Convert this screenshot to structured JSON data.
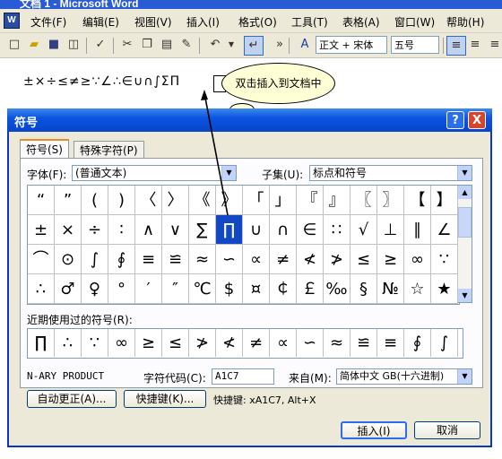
{
  "window": {
    "title": "文档 1 - Microsoft Word"
  },
  "menubar": {
    "items": [
      "文件(F)",
      "编辑(E)",
      "视图(V)",
      "插入(I)",
      "格式(O)",
      "工具(T)",
      "表格(A)",
      "窗口(W)",
      "帮助(H)"
    ]
  },
  "toolbar": {
    "style_value": "正文 + 宋体",
    "size_value": "五号"
  },
  "document": {
    "symbol_text": "±×÷≤≠≥∵∠∴∈∪∩∫ΣΠ",
    "callout": "双击插入到文档中"
  },
  "dialog": {
    "title": "符号",
    "help_label": "?",
    "close_label": "X",
    "tabs": [
      "符号(S)",
      "特殊字符(P)"
    ],
    "font_label": "字体(F):",
    "font_value": "(普通文本)",
    "subset_label": "子集(U):",
    "subset_value": "标点和符号",
    "grid": [
      [
        "“",
        "”",
        "(",
        ")",
        "〈",
        "〉",
        "《",
        "》",
        "「",
        "」",
        "『",
        "』",
        "〖",
        "〗",
        "【",
        "】"
      ],
      [
        "±",
        "×",
        "÷",
        "∶",
        "∧",
        "∨",
        "∑",
        "∏",
        "∪",
        "∩",
        "∈",
        "∷",
        "√",
        "⊥",
        "∥",
        "∠"
      ],
      [
        "⌒",
        "⊙",
        "∫",
        "∮",
        "≡",
        "≌",
        "≈",
        "∽",
        "∝",
        "≠",
        "≮",
        "≯",
        "≤",
        "≥",
        "∞",
        "∵"
      ],
      [
        "∴",
        "♂",
        "♀",
        "°",
        "′",
        "″",
        "℃",
        "$",
        "¤",
        "￠",
        "￡",
        "‰",
        "§",
        "№",
        "☆",
        "★"
      ]
    ],
    "selected_cell": "∏",
    "recent_label": "近期使用过的符号(R):",
    "recent": [
      "∏",
      "∴",
      "∵",
      "∞",
      "≥",
      "≤",
      "≯",
      "≮",
      "≠",
      "∝",
      "∽",
      "≈",
      "≌",
      "≡",
      "∮",
      "∫"
    ],
    "char_name": "N-ARY PRODUCT",
    "charcode_label": "字符代码(C):",
    "charcode_value": "A1C7",
    "from_label": "来自(M):",
    "from_value": "简体中文 GB(十六进制)",
    "autocorrect_button": "自动更正(A)...",
    "shortcut_button": "快捷键(K)...",
    "shortcut_text": "快捷键: xA1C7, Alt+X",
    "insert_button": "插入(I)",
    "cancel_button": "取消"
  }
}
